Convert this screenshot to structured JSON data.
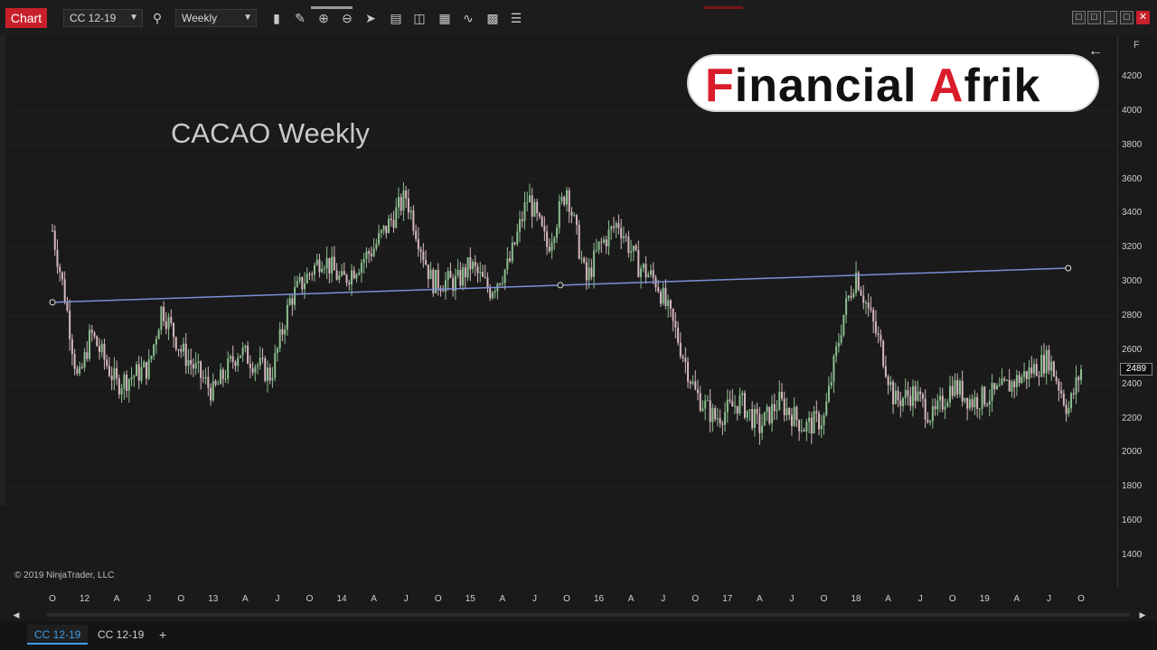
{
  "toolbar": {
    "chart_label": "Chart",
    "instrument": "CC 12-19",
    "interval": "Weekly"
  },
  "chart": {
    "title": "CACAO Weekly",
    "copyright": "© 2019 NinjaTrader, LLC",
    "last_price": "2489",
    "price_panel_label": "F"
  },
  "logo": {
    "part1": "F",
    "part2": "inancial ",
    "part3": "A",
    "part4": "frik"
  },
  "tabs": [
    {
      "label": "CC 12-19",
      "active": true
    },
    {
      "label": "CC 12-19",
      "active": false
    }
  ],
  "tab_add_label": "+",
  "colors": {
    "accent": "#c8202a",
    "tab_active": "#3e9ee8",
    "up_bar": "#8bbf8f",
    "down_bar": "#d6b8bf",
    "trendline": "#7a90d6"
  },
  "chart_data": {
    "type": "line",
    "title": "CACAO Weekly",
    "x_tick_labels": [
      "O",
      "12",
      "A",
      "J",
      "O",
      "13",
      "A",
      "J",
      "O",
      "14",
      "A",
      "J",
      "O",
      "15",
      "A",
      "J",
      "O",
      "16",
      "A",
      "J",
      "O",
      "17",
      "A",
      "J",
      "O",
      "18",
      "A",
      "J",
      "O",
      "19",
      "A",
      "J",
      "O"
    ],
    "y_tick_labels": [
      "4200",
      "4000",
      "3800",
      "3600",
      "3400",
      "3200",
      "3000",
      "2800",
      "2600",
      "2400",
      "2200",
      "2000",
      "1800",
      "1600",
      "1400"
    ],
    "ylim": [
      1300,
      4400
    ],
    "price_path_x": [
      2011.75,
      2011.85,
      2011.95,
      2012.05,
      2012.25,
      2012.5,
      2012.6,
      2012.75,
      2013.0,
      2013.2,
      2013.45,
      2013.6,
      2013.85,
      2014.0,
      2014.25,
      2014.5,
      2014.7,
      2014.9,
      2015.0,
      2015.15,
      2015.3,
      2015.45,
      2015.6,
      2015.75,
      2015.9,
      2016.0,
      2016.15,
      2016.3,
      2016.45,
      2016.6,
      2016.75,
      2016.9,
      2017.1,
      2017.25,
      2017.4,
      2017.6,
      2017.75,
      2017.9,
      2018.0,
      2018.2,
      2018.3,
      2018.45,
      2018.6,
      2018.75,
      2018.9,
      2019.1,
      2019.3,
      2019.5,
      2019.65,
      2019.75
    ],
    "price_path_y": [
      3300,
      2900,
      2400,
      2700,
      2400,
      2500,
      2850,
      2600,
      2350,
      2600,
      2450,
      2900,
      3150,
      3000,
      3200,
      3500,
      3000,
      3000,
      3100,
      2950,
      3100,
      3500,
      3200,
      3550,
      3000,
      3200,
      3350,
      3100,
      3000,
      2700,
      2350,
      2200,
      2300,
      2150,
      2300,
      2150,
      2200,
      2800,
      3050,
      2600,
      2300,
      2350,
      2200,
      2400,
      2300,
      2350,
      2450,
      2550,
      2250,
      2489
    ],
    "trendline": {
      "start": [
        2011.75,
        2880
      ],
      "end": [
        2019.65,
        3080
      ]
    },
    "last_price": 2489
  }
}
